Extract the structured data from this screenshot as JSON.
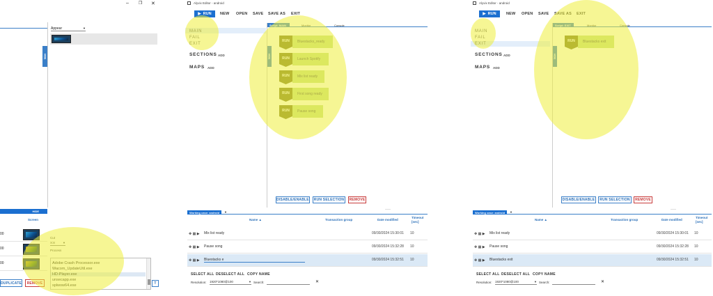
{
  "left_panel": {
    "window_controls": {
      "minimize": "–",
      "maximize": "❐",
      "close": "✕"
    },
    "appear_dropdown": "Appear",
    "hide_top": "HIDE",
    "hide_bottom": "HIDE",
    "screen_header": "Screen",
    "rows": [
      {
        "value": "00"
      },
      {
        "value": "00"
      },
      {
        "value": "00"
      }
    ],
    "cut_label": "Cut",
    "cut_value": "X:8",
    "process_label": "Process",
    "process_list": [
      "Adobe Crash Processor.exe",
      "Wacom_UpdateUtil.exe",
      "HD-Player.exe",
      "unsecapp.exe",
      "splwow64.exe"
    ],
    "duplicate_button": "DUPLICATE",
    "remove_button": "REMOVE",
    "ok_fragment": "T"
  },
  "panels": [
    {
      "title": "Alyvix Editor - android",
      "toolbar": {
        "run": "RUN",
        "new": "NEW",
        "open": "OPEN",
        "save": "SAVE",
        "save_as": "SAVE AS",
        "exit": "EXIT"
      },
      "nav": {
        "main": "MAIN",
        "fail": "FAIL",
        "exit": "EXIT"
      },
      "sections_label": "SECTIONS",
      "maps_label": "MAPS",
      "add_label": "ADD",
      "tabs": {
        "script": "Script: MAIN",
        "monitor": "Monitor",
        "console": "Console"
      },
      "hide_handle": "HIDE",
      "steps": [
        {
          "tag": "RUN",
          "label": "Bluestacks_ready"
        },
        {
          "tag": "RUN",
          "label": "Launch Spotify"
        },
        {
          "tag": "RUN",
          "label": "Mix list ready"
        },
        {
          "tag": "RUN",
          "label": "First song ready"
        },
        {
          "tag": "RUN",
          "label": "Pause song"
        }
      ],
      "actions": {
        "disable_enable": "DISABLE/ENABLE",
        "run_selection": "RUN SELECTION",
        "remove": "REMOVE"
      },
      "working_case": "Working case: android",
      "working_case_arrow": "▼",
      "table_headers": {
        "name": "Name ▲",
        "transaction_group": "Transaction group",
        "date_modified": "Date modified",
        "timeout": "Timeout [sec]"
      },
      "rows": [
        {
          "name": "Mix list ready",
          "date": "09/30/2024 15:30:01",
          "timeout": "10"
        },
        {
          "name": "Pause song",
          "date": "09/30/2024 15:32:28",
          "timeout": "10"
        },
        {
          "name": "Bluestacks e",
          "date": "09/30/2024 15:32:51",
          "timeout": "10"
        }
      ],
      "bottom": {
        "select_all": "SELECT ALL",
        "deselect_all": "DESELECT ALL",
        "copy_name": "COPY NAME",
        "resolution_label": "Resolution:",
        "resolution_value": "1920*1080@100",
        "search_label": "Search:",
        "clear": "✕"
      }
    },
    {
      "title": "Alyvix Editor - android",
      "toolbar": {
        "run": "RUN",
        "new": "NEW",
        "open": "OPEN",
        "save": "SAVE",
        "save_as": "SAVE AS",
        "exit": "EXIT"
      },
      "nav": {
        "main": "MAIN",
        "fail": "FAIL",
        "exit": "EXIT"
      },
      "sections_label": "SECTIONS",
      "maps_label": "MAPS",
      "add_label": "ADD",
      "tabs": {
        "script": "Script: EXIT",
        "monitor": "Monitor",
        "console": "Console"
      },
      "hide_handle": "HIDE",
      "steps": [
        {
          "tag": "RUN",
          "label": "Bluestacks exit"
        }
      ],
      "actions": {
        "disable_enable": "DISABLE/ENABLE",
        "run_selection": "RUN SELECTION",
        "remove": "REMOVE"
      },
      "working_case": "Working case: android",
      "working_case_arrow": "▼",
      "table_headers": {
        "name": "Name ▲",
        "transaction_group": "Transaction group",
        "date_modified": "Date modified",
        "timeout": "Timeout [sec]"
      },
      "rows": [
        {
          "name": "Mix list ready",
          "date": "09/30/2024 15:30:01",
          "timeout": "10"
        },
        {
          "name": "Pause song",
          "date": "09/30/2024 15:32:28",
          "timeout": "10"
        },
        {
          "name": "Bluestacks exit",
          "date": "09/30/2024 15:32:51",
          "timeout": "10"
        }
      ],
      "bottom": {
        "select_all": "SELECT ALL",
        "deselect_all": "DESELECT ALL",
        "copy_name": "COPY NAME",
        "resolution_label": "Resolution:",
        "resolution_value": "1920*1080@100",
        "search_label": "Search:",
        "clear": "✕"
      }
    }
  ],
  "icons": {
    "play": "play-icon",
    "move": "move-icon",
    "grid": "grid-icon"
  },
  "colors": {
    "accent": "#1b6fd0",
    "step_tag": "#7b7a24",
    "step_label": "#c5e08a",
    "highlight": "#eeee3c",
    "remove": "#c83a3a"
  }
}
